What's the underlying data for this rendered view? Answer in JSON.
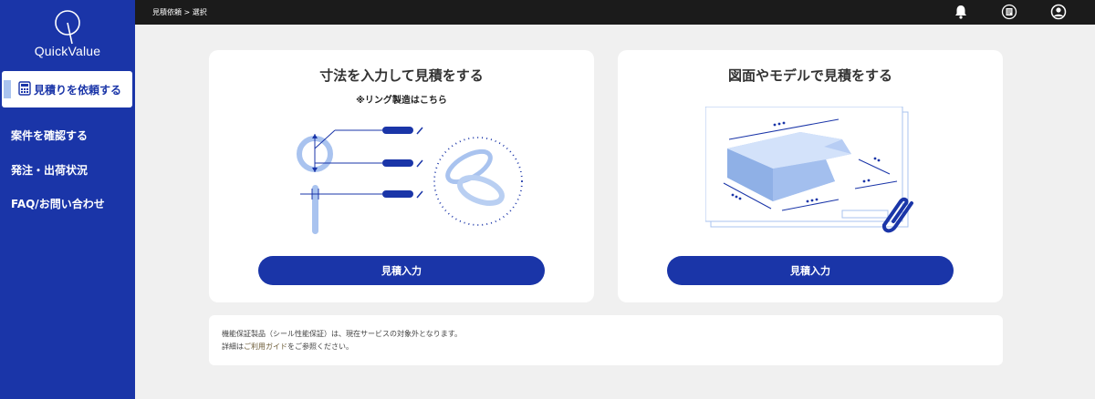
{
  "app": {
    "name": "QuickValue"
  },
  "sidebar": {
    "active_item": {
      "label": "見積りを依頼する",
      "icon": "calculator-icon"
    },
    "items": [
      {
        "label": "案件を確認する"
      },
      {
        "label": "発注・出荷状況"
      },
      {
        "label": "FAQ/お問い合わせ"
      }
    ]
  },
  "header": {
    "breadcrumb": "見積依頼 > 選択",
    "icons": [
      "bell-icon",
      "document-list-icon",
      "user-account-icon"
    ]
  },
  "cards": [
    {
      "title": "寸法を入力して見積をする",
      "subtitle": "※リング製造はこちら",
      "button_label": "見積入力",
      "illustration": "ring-dimensions-illustration"
    },
    {
      "title": "図面やモデルで見積をする",
      "button_label": "見積入力",
      "illustration": "drawing-model-illustration"
    }
  ],
  "notice": {
    "line1": "機能保証製品（シール性能保証）は、現在サービスの対象外となります。",
    "line2_prefix": "詳細は",
    "line2_link": "ご利用ガイド",
    "line2_suffix": "をご参照ください。"
  },
  "colors": {
    "brand": "#1a35a8",
    "topbar": "#1b1b1b",
    "background": "#f0f0f0",
    "illustration_light": "#a9c3ef"
  }
}
